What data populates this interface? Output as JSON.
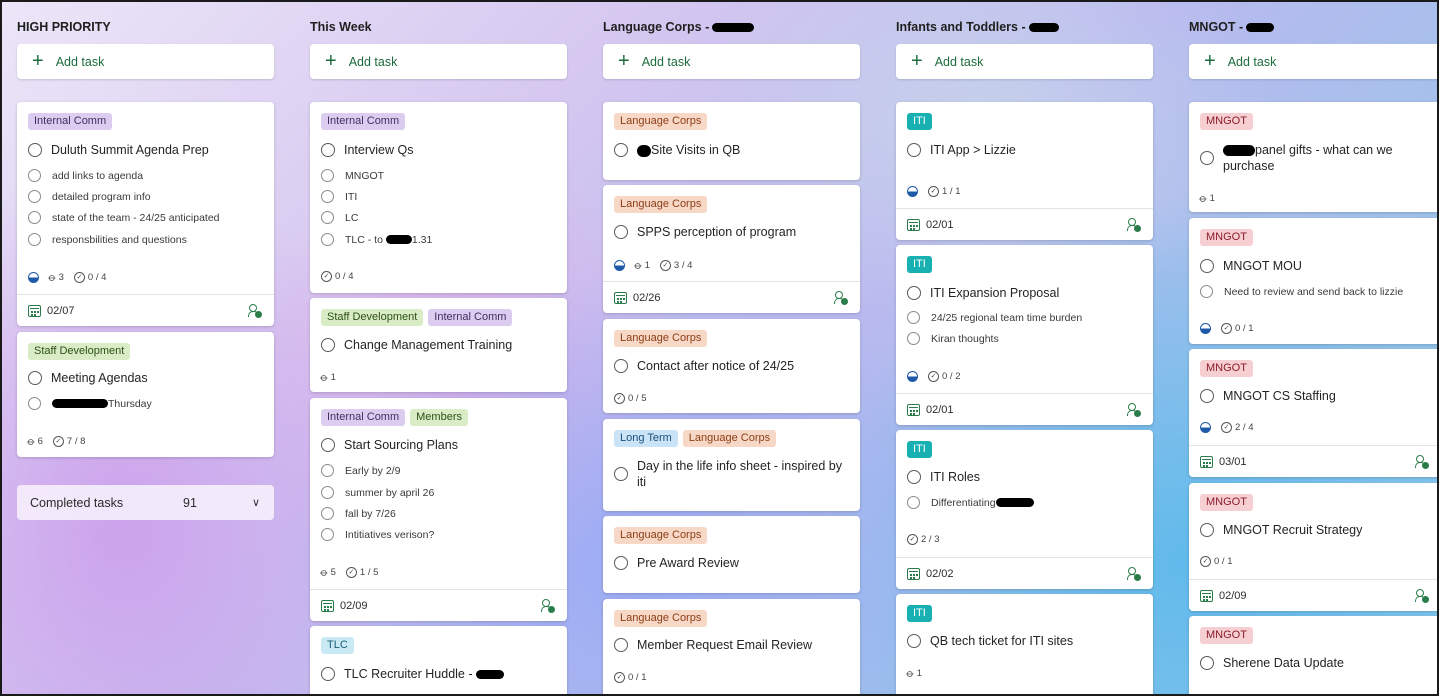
{
  "columns": [
    {
      "title": "HIGH PRIORITY",
      "add_label": "Add task",
      "completed": {
        "label": "Completed tasks",
        "count": "91"
      },
      "cards": [
        {
          "tags": [
            "Internal Comm"
          ],
          "title": "Duluth Summit Agenda Prep",
          "subtasks": [
            "add links to agenda",
            "detailed program info",
            "state of the team - 24/25 anticipated",
            "responsbilities and questions"
          ],
          "attach": "3",
          "progress": "0 / 4",
          "date": "02/07"
        },
        {
          "tags": [
            "Staff Development"
          ],
          "title": "Meeting Agendas",
          "subtasks": [
            "Thursday"
          ],
          "attach": "6",
          "progress": "7 / 8"
        }
      ]
    },
    {
      "title": "This Week",
      "add_label": "Add task",
      "cards": [
        {
          "tags": [
            "Internal Comm"
          ],
          "title": "Interview Qs",
          "subtasks": [
            "MNGOT",
            "ITI",
            "LC",
            "TLC - to",
            "1.31"
          ],
          "progress": "0 / 4"
        },
        {
          "tags": [
            "Staff Development",
            "Internal Comm"
          ],
          "title": "Change Management Training",
          "attach": "1"
        },
        {
          "tags": [
            "Internal Comm",
            "Members"
          ],
          "title": "Start Sourcing Plans",
          "subtasks": [
            "Early by 2/9",
            "summer by april 26",
            "fall by 7/26",
            "Intitiatives verison?"
          ],
          "attach": "5",
          "progress": "1 / 5",
          "date": "02/09"
        },
        {
          "tags": [
            "TLC"
          ],
          "title": "TLC Recruiter Huddle -"
        }
      ]
    },
    {
      "title": "Language Corps -",
      "add_label": "Add task",
      "cards": [
        {
          "tags": [
            "Language Corps"
          ],
          "title": "Site Visits in QB"
        },
        {
          "tags": [
            "Language Corps"
          ],
          "title": "SPPS perception of program",
          "attach": "1",
          "progress": "3 / 4",
          "date": "02/26"
        },
        {
          "tags": [
            "Language Corps"
          ],
          "title": "Contact after notice of 24/25",
          "progress": "0 / 5"
        },
        {
          "tags": [
            "Long Term",
            "Language Corps"
          ],
          "title": "Day in the life info sheet - inspired by iti"
        },
        {
          "tags": [
            "Language Corps"
          ],
          "title": "Pre Award Review"
        },
        {
          "tags": [
            "Language Corps"
          ],
          "title": "Member Request Email Review",
          "progress": "0 / 1"
        }
      ]
    },
    {
      "title": "Infants and Toddlers -",
      "add_label": "Add task",
      "cards": [
        {
          "tags": [
            "ITI"
          ],
          "title": "ITI App > Lizzie",
          "progress": "1 / 1",
          "date": "02/01"
        },
        {
          "tags": [
            "ITI"
          ],
          "title": "ITI Expansion Proposal",
          "subtasks": [
            "24/25 regional team time burden",
            "Kiran thoughts"
          ],
          "progress": "0 / 2",
          "date": "02/01"
        },
        {
          "tags": [
            "ITI"
          ],
          "title": "ITI Roles",
          "subtasks": [
            "Differentiating"
          ],
          "progress": "2 / 3",
          "date": "02/02"
        },
        {
          "tags": [
            "ITI"
          ],
          "title": "QB tech ticket for ITI sites",
          "attach": "1"
        }
      ]
    },
    {
      "title": "MNGOT -",
      "add_label": "Add task",
      "cards": [
        {
          "tags": [
            "MNGOT"
          ],
          "title": "panel gifts - what can we purchase",
          "attach": "1"
        },
        {
          "tags": [
            "MNGOT"
          ],
          "title": "MNGOT MOU",
          "subtasks": [
            "Need to review and send back to lizzie"
          ],
          "progress": "0 / 1"
        },
        {
          "tags": [
            "MNGOT"
          ],
          "title": "MNGOT CS Staffing",
          "progress": "2 / 4",
          "date": "03/01"
        },
        {
          "tags": [
            "MNGOT"
          ],
          "title": "MNGOT Recruit Strategy",
          "progress": "0 / 1",
          "date": "02/09"
        },
        {
          "tags": [
            "MNGOT"
          ],
          "title": "Sherene Data Update"
        }
      ]
    }
  ]
}
